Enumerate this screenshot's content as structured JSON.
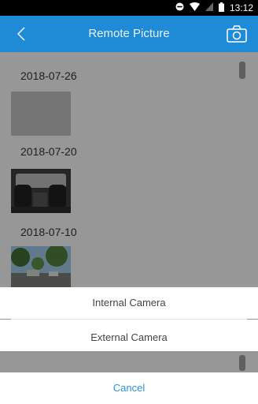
{
  "status_bar": {
    "time": "13:12",
    "icons": [
      "do-not-disturb-icon",
      "wifi-icon",
      "signal-icon",
      "battery-icon"
    ]
  },
  "header": {
    "title": "Remote Picture",
    "back_icon": "back-chevron-icon",
    "camera_icon": "camera-icon",
    "color": "#1f8bd6"
  },
  "gallery": {
    "groups": [
      {
        "date": "2018-07-26",
        "thumbnail": "gray-placeholder"
      },
      {
        "date": "2018-07-20",
        "thumbnail": "car-interior-photo"
      },
      {
        "date": "2018-07-10",
        "thumbnail": "street-trees-photo"
      }
    ]
  },
  "action_sheet": {
    "options": [
      "Internal Camera",
      "External Camera"
    ],
    "cancel_label": "Cancel",
    "cancel_color": "#2a93d9"
  }
}
